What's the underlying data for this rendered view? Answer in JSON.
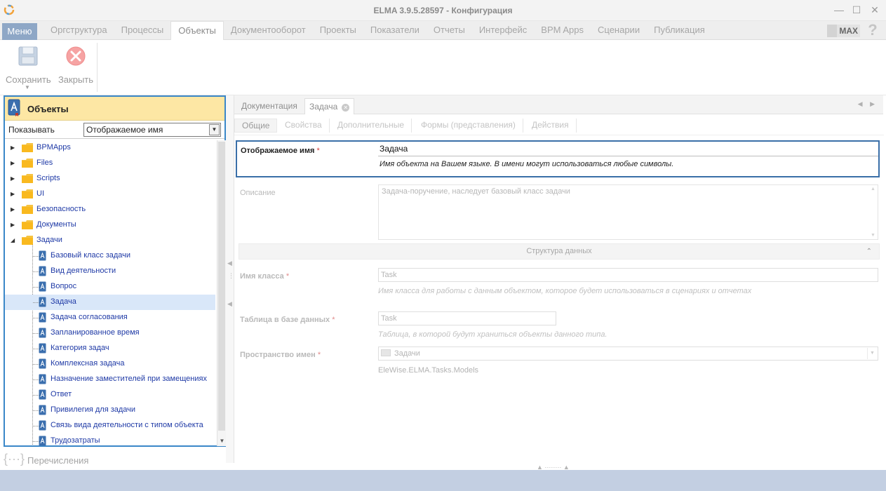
{
  "window": {
    "title": "ELMA 3.9.5.28597 - Конфигурация",
    "minimize": "—",
    "maximize": "☐",
    "close": "✕"
  },
  "menubar": {
    "menu_label": "Меню",
    "tabs": [
      {
        "label": "Оргструктура"
      },
      {
        "label": "Процессы"
      },
      {
        "label": "Объекты"
      },
      {
        "label": "Документооборот"
      },
      {
        "label": "Проекты"
      },
      {
        "label": "Показатели"
      },
      {
        "label": "Отчеты"
      },
      {
        "label": "Интерфейс"
      },
      {
        "label": "BPM Apps"
      },
      {
        "label": "Сценарии"
      },
      {
        "label": "Публикация"
      }
    ],
    "active_tab": "Объекты",
    "max_label": "MAX",
    "help": "?"
  },
  "toolbar": {
    "save_label": "Сохранить",
    "close_label": "Закрыть",
    "dropdown": "▼"
  },
  "left_panel": {
    "header_title": "Объекты",
    "show_label": "Показывать",
    "show_value": "Отображаемое имя",
    "select_arrow": "▼",
    "tree": [
      {
        "label": "BPMApps",
        "type": "folder",
        "expander": "▶"
      },
      {
        "label": "Files",
        "type": "folder",
        "expander": "▶"
      },
      {
        "label": "Scripts",
        "type": "folder",
        "expander": "▶"
      },
      {
        "label": "UI",
        "type": "folder",
        "expander": "▶"
      },
      {
        "label": "Безопасность",
        "type": "folder",
        "expander": "▶"
      },
      {
        "label": "Документы",
        "type": "folder",
        "expander": "▶"
      },
      {
        "label": "Задачи",
        "type": "folder",
        "expander": "◢"
      },
      {
        "label": "Базовый класс задачи",
        "type": "object"
      },
      {
        "label": "Вид деятельности",
        "type": "object"
      },
      {
        "label": "Вопрос",
        "type": "object"
      },
      {
        "label": "Задача",
        "type": "object",
        "selected": true
      },
      {
        "label": "Задача согласования",
        "type": "object"
      },
      {
        "label": "Запланированное время",
        "type": "object"
      },
      {
        "label": "Категория задач",
        "type": "object"
      },
      {
        "label": "Комплексная задача",
        "type": "object"
      },
      {
        "label": "Назначение заместителей при замещениях",
        "type": "object"
      },
      {
        "label": "Ответ",
        "type": "object"
      },
      {
        "label": "Привилегия для задачи",
        "type": "object"
      },
      {
        "label": "Связь вида деятельности с типом объекта",
        "type": "object"
      },
      {
        "label": "Трудозатраты",
        "type": "object"
      }
    ],
    "scroll_arrow": "▼",
    "enumerations_label": "Перечисления",
    "enumerations_icon": "{···}"
  },
  "right_panel": {
    "doc_tabs": [
      {
        "label": "Документация"
      },
      {
        "label": "Задача"
      }
    ],
    "doc_tab_close": "✕",
    "nav_arrows": "◀ ▶",
    "sub_tabs": [
      {
        "label": "Общие"
      },
      {
        "label": "Свойства"
      },
      {
        "label": "Дополнительные"
      },
      {
        "label": "Формы (представления)"
      },
      {
        "label": "Действия"
      }
    ],
    "required_mark": "*",
    "display_name": {
      "label": "Отображаемое имя",
      "value": "Задача",
      "hint": "Имя объекта на Вашем языке. В имени могут использоваться любые символы."
    },
    "description": {
      "label": "Описание",
      "value": "Задача-поручение, наследует базовый класс задачи"
    },
    "section_title": "Структура данных",
    "section_chevron": "⌃",
    "class_name": {
      "label": "Имя класса",
      "value": "Task",
      "hint": "Имя класса для работы с данным объектом, которое будет использоваться в сценариях и отчетах"
    },
    "db_table": {
      "label": "Таблица в базе данных",
      "value": "Task",
      "hint": "Таблица, в которой будут храниться объекты данного типа."
    },
    "namespace": {
      "label": "Пространство имен",
      "value": "Задачи",
      "full": "EleWise.ELMA.Tasks.Models"
    }
  },
  "colors": {
    "accent_border": "#3a87c8",
    "menu_button": "#8ea7c6",
    "panel_header": "#fde7a4",
    "status_bar": "#c3cfe2",
    "tree_link": "#1f3aa6"
  }
}
